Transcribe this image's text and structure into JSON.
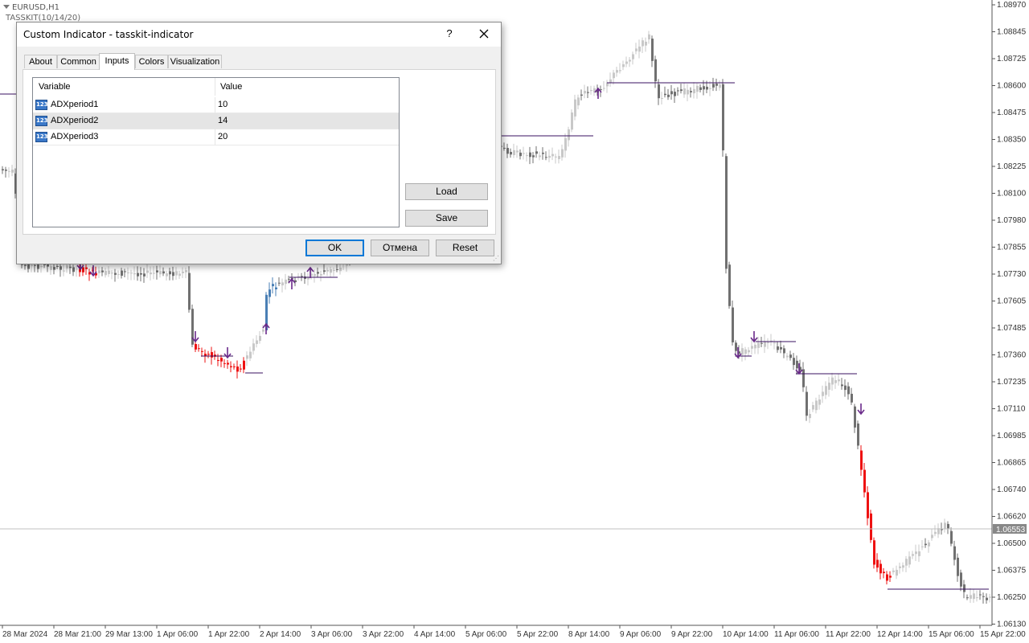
{
  "chart": {
    "symbol": "EURUSD,H1",
    "indicator_label": "TASSKIT(10/14/20)",
    "current_price": "1.06553",
    "price_labels": [
      "1.08970",
      "1.08845",
      "1.08725",
      "1.08600",
      "1.08475",
      "1.08350",
      "1.08225",
      "1.08100",
      "1.07980",
      "1.07855",
      "1.07730",
      "1.07605",
      "1.07485",
      "1.07360",
      "1.07235",
      "1.07110",
      "1.06985",
      "1.06865",
      "1.06740",
      "1.06620",
      "1.06500",
      "1.06375",
      "1.06250",
      "1.06130"
    ],
    "time_labels": [
      "28 Mar 2024",
      "28 Mar 21:00",
      "29 Mar 13:00",
      "1 Apr 06:00",
      "1 Apr 22:00",
      "2 Apr 14:00",
      "3 Apr 06:00",
      "3 Apr 22:00",
      "4 Apr 14:00",
      "5 Apr 06:00",
      "5 Apr 22:00",
      "8 Apr 14:00",
      "9 Apr 06:00",
      "9 Apr 22:00",
      "10 Apr 14:00",
      "11 Apr 06:00",
      "11 Apr 22:00",
      "12 Apr 14:00",
      "15 Apr 06:00",
      "15 Apr 22:00"
    ],
    "colors": {
      "bull": "#c8c8c8",
      "bear": "#707070",
      "sell": "#ee1111",
      "buy": "#4a7fb5",
      "arrow": "#6a2a8a",
      "level": "#3a1060",
      "axis_bg": "#ffffff",
      "price_tag": "#888888"
    }
  },
  "dialog": {
    "title": "Custom Indicator - tasskit-indicator",
    "help_label": "?",
    "tabs": [
      {
        "label": "About",
        "active": false
      },
      {
        "label": "Common",
        "active": false
      },
      {
        "label": "Inputs",
        "active": true
      },
      {
        "label": "Colors",
        "active": false
      },
      {
        "label": "Visualization",
        "active": false
      }
    ],
    "grid": {
      "col_variable": "Variable",
      "col_value": "Value",
      "icon_text": "123",
      "rows": [
        {
          "name": "ADXperiod1",
          "value": "10"
        },
        {
          "name": "ADXperiod2",
          "value": "14"
        },
        {
          "name": "ADXperiod3",
          "value": "20"
        }
      ]
    },
    "load_label": "Load",
    "save_label": "Save",
    "ok_label": "OK",
    "cancel_label": "Отмена",
    "reset_label": "Reset"
  }
}
